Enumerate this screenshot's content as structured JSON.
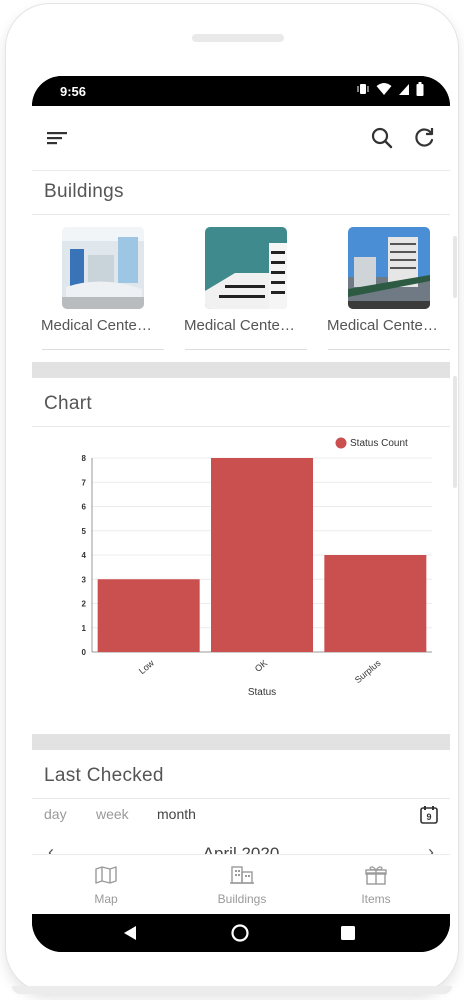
{
  "status_bar": {
    "time": "9:56"
  },
  "header": {
    "menu_icon": "sort-menu-icon",
    "search_icon": "search-icon",
    "refresh_icon": "refresh-icon"
  },
  "buildings": {
    "title": "Buildings",
    "items": [
      {
        "label": "Medical Cente…"
      },
      {
        "label": "Medical Cente…"
      },
      {
        "label": "Medical Cente…"
      }
    ]
  },
  "chart_section": {
    "title": "Chart"
  },
  "chart_data": {
    "type": "bar",
    "categories": [
      "Low",
      "OK",
      "Surplus"
    ],
    "series": [
      {
        "name": "Status Count",
        "values": [
          3,
          8,
          4
        ]
      }
    ],
    "xlabel": "Status",
    "ylabel": "",
    "ylim": [
      0,
      8
    ],
    "yticks": [
      "0",
      "1",
      "2",
      "3",
      "4",
      "5",
      "6",
      "7",
      "8"
    ],
    "legend": "top-right",
    "grid": true,
    "color": "#c9504f"
  },
  "last_checked": {
    "title": "Last Checked",
    "tabs": [
      "day",
      "week",
      "month"
    ],
    "active_tab": "month",
    "calendar_icon": "calendar-icon",
    "calendar_badge": "9",
    "month_label": "April 2020"
  },
  "bottom_nav": {
    "items": [
      {
        "label": "Map",
        "icon": "map-icon"
      },
      {
        "label": "Buildings",
        "icon": "buildings-icon"
      },
      {
        "label": "Items",
        "icon": "gift-box-icon"
      }
    ]
  },
  "colors": {
    "accent": "#c9504f",
    "band": "#e2e2e2",
    "text": "#555555"
  }
}
